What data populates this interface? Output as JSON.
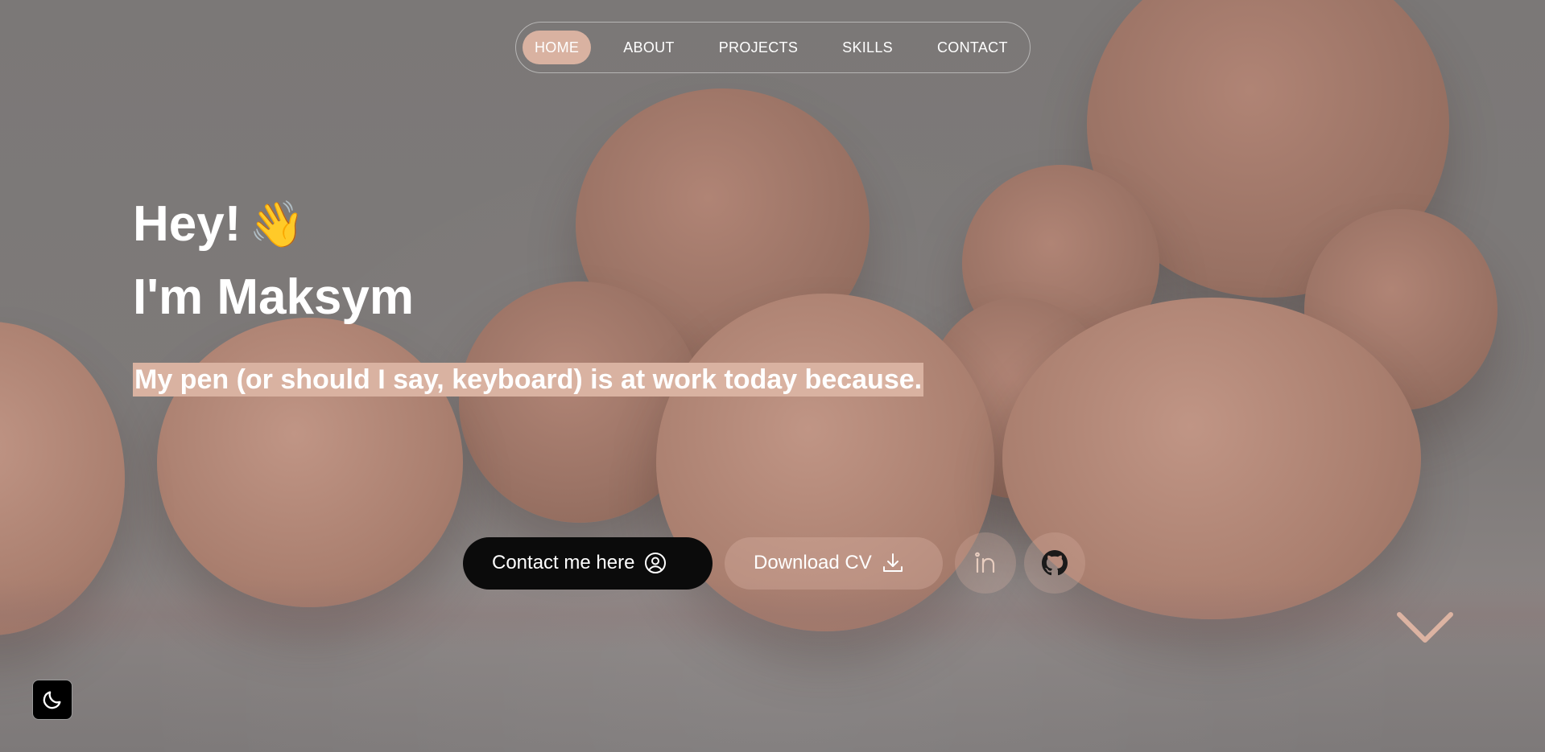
{
  "nav": {
    "items": [
      {
        "label": "HOME",
        "active": true
      },
      {
        "label": "ABOUT",
        "active": false
      },
      {
        "label": "PROJECTS",
        "active": false
      },
      {
        "label": "SKILLS",
        "active": false
      },
      {
        "label": "CONTACT",
        "active": false
      }
    ]
  },
  "hero": {
    "greeting": "Hey!",
    "greeting_icon": "waving-hand-icon",
    "name": "I'm Maksym",
    "tagline": "My pen (or should I say, keyboard) is at work today because."
  },
  "actions": {
    "contact_label": "Contact me here",
    "contact_icon": "user-circle-icon",
    "download_label": "Download CV",
    "download_icon": "download-icon",
    "linkedin_icon": "linkedin-icon",
    "github_icon": "github-icon"
  },
  "colors": {
    "accent": "#d9b2a1",
    "dark_button": "#0b0b0b",
    "background": "#7d7b7a"
  },
  "controls": {
    "scroll_icon": "chevron-down-icon",
    "theme_icon": "moon-icon"
  }
}
